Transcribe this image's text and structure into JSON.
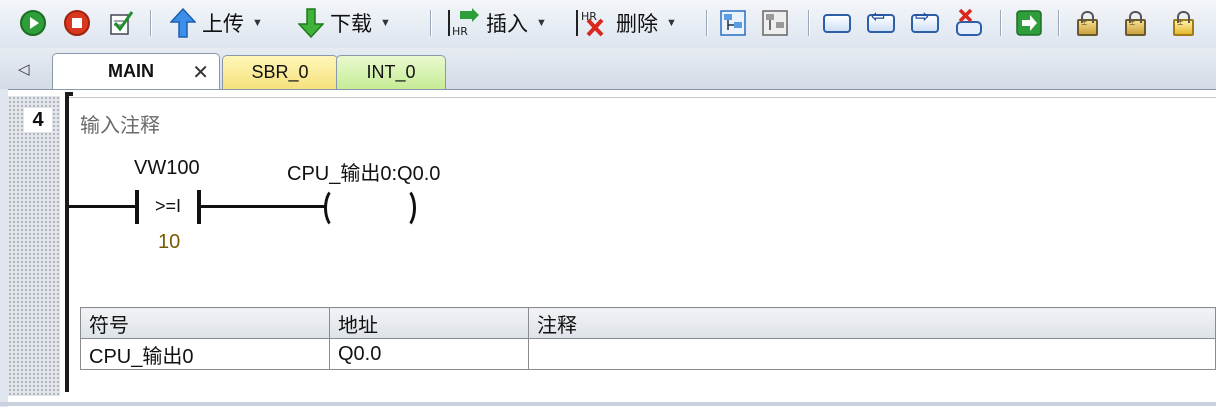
{
  "toolbar": {
    "upload_label": "上传",
    "download_label": "下载",
    "insert_label": "插入",
    "delete_label": "删除"
  },
  "tabs": [
    {
      "label": "MAIN"
    },
    {
      "label": "SBR_0"
    },
    {
      "label": "INT_0"
    }
  ],
  "network": {
    "number": "4",
    "comment": "输入注释",
    "contact": {
      "address": "VW100",
      "op": ">=I",
      "compare_value": "10"
    },
    "coil": {
      "symbol": "CPU_输出0:Q0.0"
    }
  },
  "symbol_table": {
    "headers": [
      "符号",
      "地址",
      "注释"
    ],
    "rows": [
      [
        "CPU_输出0",
        "Q0.0",
        ""
      ]
    ]
  },
  "colors": {
    "run_green": "#2e9e3a",
    "stop_red": "#d9381e",
    "compare_value": "#7a5a00",
    "sbr_tab": "#f5e27c",
    "int_tab": "#c6ec96"
  }
}
